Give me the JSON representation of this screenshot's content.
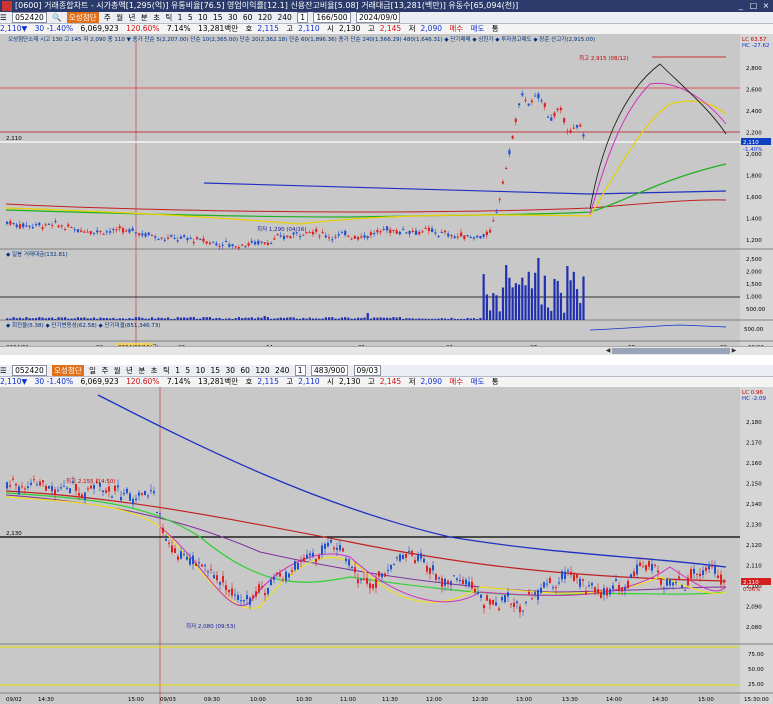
{
  "window": {
    "title": "[0600] 거래종합차트 - 시가총액[1,295(억)] 유통비율[76.5] 영업이익률[12.1] 신용잔고비율[5.08] 거래대금[13,281(백만)] 유동수[65,094(천)]",
    "controls": [
      "_",
      "□",
      "×"
    ]
  },
  "top": {
    "toolbar": {
      "code": "052420",
      "mode": "오성첨단",
      "periods": [
        "주",
        "월",
        "년",
        "분",
        "초",
        "틱"
      ],
      "intervals": [
        "1",
        "5",
        "10",
        "15",
        "30",
        "60",
        "120",
        "240"
      ],
      "count": "1",
      "range": "166/500",
      "date": "2024/09/0"
    },
    "info": {
      "price": "2,110▼",
      "change": "30 -1.40%",
      "volume": "6,069,923",
      "vol_ratio": "120.60%",
      "turnover": "7.14%",
      "amount": "13,281백만",
      "open_label": "호",
      "open": "2,115",
      "high_label": "고",
      "high": "2,110",
      "mid_label": "시",
      "mid": "2,130",
      "low_label": "고",
      "low": "2,145",
      "last_label": "저",
      "last": "2,090",
      "btn1": "매수",
      "btn2": "매도",
      "btn3": "통"
    },
    "legend": "오성첨단소재 시고 130 고 145 저 2,090 종 110 ▼  종가 단순 5(2,207.00)  단순 10(2,365.00)  단순 20(2,362.18)  단순 60(1,896.36)  종가 단순 240(1,566.29)  480(1,646.31)  ◆ 단기매매  ◆ 상한가  ◆ 투자경고매도  ◆ 장준 산고가(2,915.00)",
    "peak_label": "최고 2,915 (08/12)",
    "low_label": "최저 1,290 (04/16)",
    "yaxis": [
      "2,800",
      "2,600",
      "2,400",
      "2,200",
      "2,000",
      "1,800",
      "1,600",
      "1,400",
      "1,200"
    ],
    "right_top": [
      "LC 63.57",
      "HC -27.62"
    ],
    "price_tag": "2,110",
    "price_tag2": "-1.40%",
    "left_line_label": "2,110",
    "vol_legend": "◆ 일봉 거래대금(132.81)",
    "vol_axis": [
      "2,500",
      "2,000",
      "1,500",
      "1,000",
      "500.00"
    ],
    "osc_legend": "◆ 회전율(5.38)  ◆ 단기변동성(62.58)  ◆ 단기미결(851,346.73)",
    "osc_axis": [
      "500.00"
    ],
    "dates": [
      "2024/01",
      "02",
      "2024/02/16(금)",
      "03",
      "04",
      "05",
      "06",
      "07",
      "08",
      "09",
      "09/03"
    ]
  },
  "bottom": {
    "toolbar": {
      "code": "052420",
      "mode": "오성첨단",
      "periods": [
        "일",
        "주",
        "월",
        "년",
        "분",
        "초",
        "틱"
      ],
      "intervals": [
        "1",
        "5",
        "10",
        "15",
        "30",
        "60",
        "120",
        "240"
      ],
      "count": "1",
      "range": "483/900",
      "date": "09/03"
    },
    "info": {
      "price": "2,110▼",
      "change": "30 -1.40%",
      "volume": "6,069,923",
      "vol_ratio": "120.60%",
      "turnover": "7.14%",
      "amount": "13,281백만",
      "open_label": "호",
      "open": "2,115",
      "high_label": "고",
      "high": "2,110",
      "mid_label": "시",
      "mid": "2,130",
      "low_label": "고",
      "low": "2,145",
      "last_label": "저",
      "last": "2,090",
      "btn1": "매수",
      "btn2": "매도",
      "btn3": "통"
    },
    "peak_label": "최고 2,155 (14:50)",
    "low_label": "최저 2,080 (09:53)",
    "left_line_label": "2,130",
    "yaxis": [
      "2,180",
      "2,170",
      "2,160",
      "2,150",
      "2,140",
      "2,130",
      "2,120",
      "2,110",
      "2,100",
      "2,090",
      "2,080"
    ],
    "right_top": [
      "LC 0.96",
      "HC -2.09"
    ],
    "price_tag": "2,110",
    "price_tag2": "0.06%",
    "osc_axis": [
      "75.00",
      "50.00",
      "25.00"
    ],
    "times": [
      "09/02",
      "14:30",
      "15:00",
      "09/03",
      "09:30",
      "10:00",
      "10:30",
      "11:00",
      "11:30",
      "12:00",
      "12:30",
      "13:00",
      "13:30",
      "14:00",
      "14:30",
      "15:00",
      "15:30:00"
    ]
  }
}
